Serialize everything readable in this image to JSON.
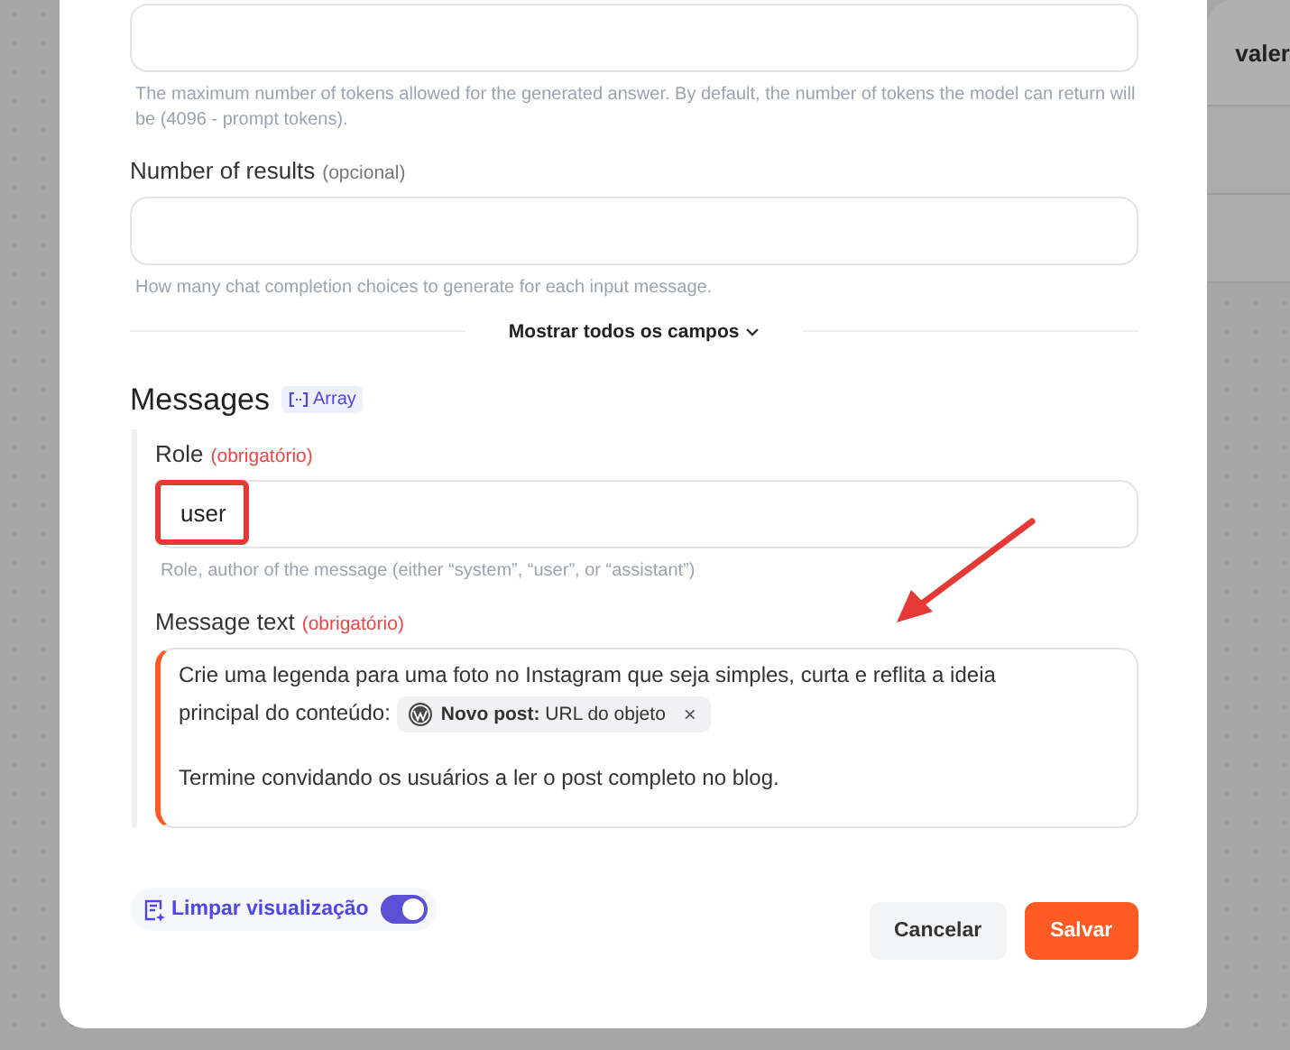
{
  "background": {
    "header_text": "valer"
  },
  "fields": [
    {
      "help": "The maximum number of tokens allowed for the generated answer. By default, the number of tokens the model can return will be (4096 - prompt tokens)."
    },
    {
      "label": "Number of results",
      "tag": "(opcional)",
      "required": false,
      "help": "How many chat completion choices to generate for each input message."
    }
  ],
  "show_all": {
    "label": "Mostrar todos os campos",
    "expanded": false
  },
  "messages": {
    "title": "Messages",
    "badge": "Array",
    "role": {
      "label": "Role",
      "tag": "(obrigatório)",
      "required": true,
      "highlighted": true,
      "value": "user",
      "help": "Role, author of the message (either “system”, “user”, or “assistant”)"
    },
    "message_text": {
      "label": "Message text",
      "tag": "(obrigatório)",
      "required": true,
      "paragraphs": [
        [
          {
            "kind": "line",
            "text": "Crie uma legenda para uma foto no Instagram que seja simples, curta e reflita a ideia"
          },
          {
            "kind": "text",
            "text": "principal do conteúdo:"
          },
          {
            "kind": "chip",
            "text": "**Novo post:** URL do objeto",
            "remove": "×"
          }
        ],
        [
          {
            "kind": "text",
            "text": "Termine convidando os usuários a ler o post completo no blog."
          }
        ]
      ]
    }
  },
  "footer": {
    "toggle": {
      "label": "Limpar visualização",
      "on": true
    },
    "buttons": [
      {
        "label": "Cancelar",
        "kind": "secondary"
      },
      {
        "label": "Salvar",
        "kind": "primary"
      }
    ]
  },
  "annotation_arrow": true
}
